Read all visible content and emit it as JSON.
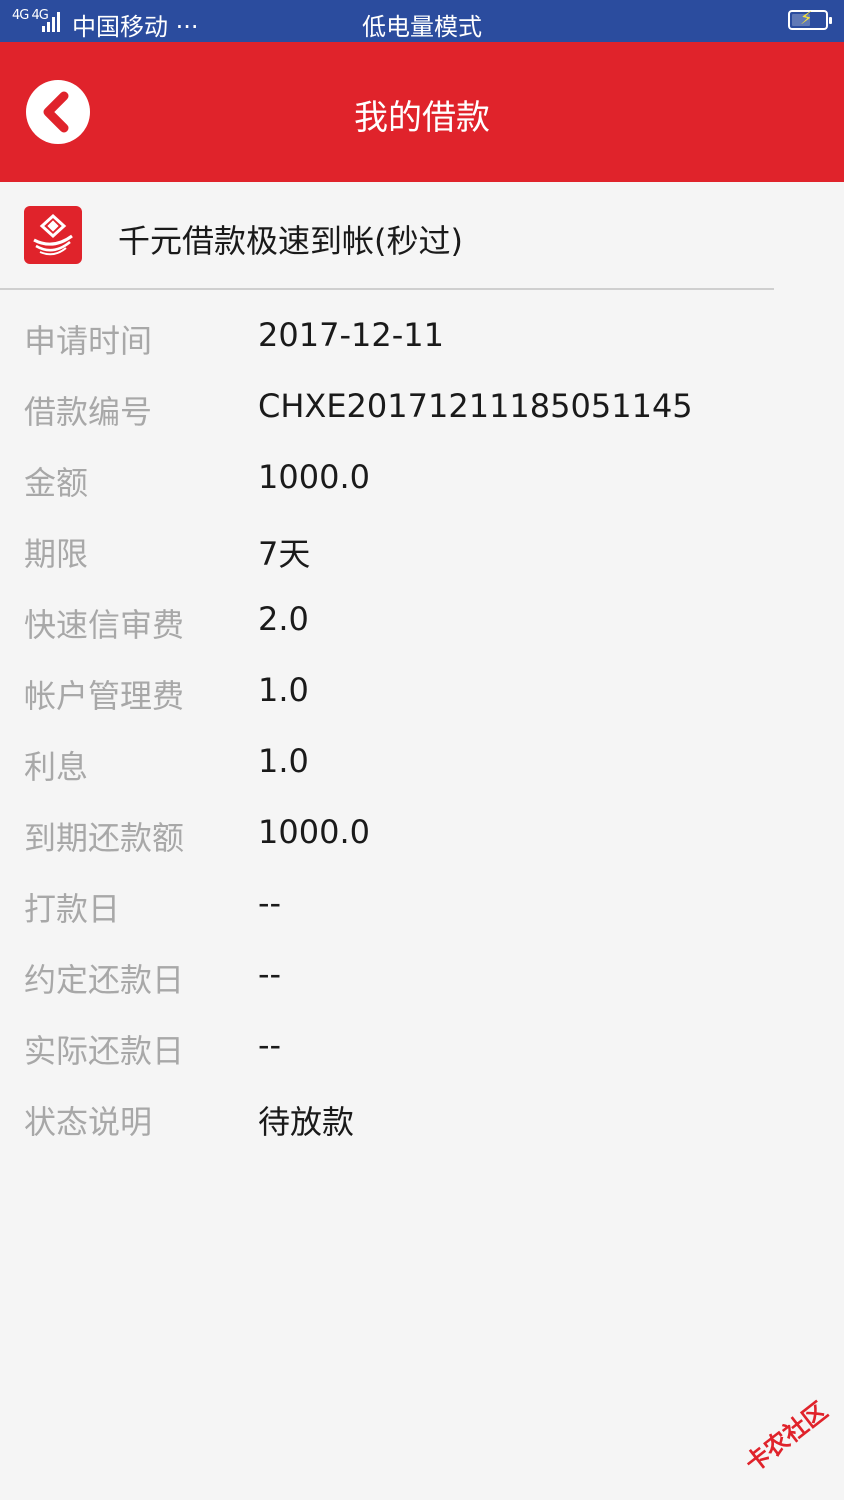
{
  "status_bar": {
    "network": "4G 4G",
    "carrier": "中国移动 ···",
    "mode": "低电量模式",
    "battery_icon": "battery-charging-icon"
  },
  "header": {
    "back_icon": "chevron-left-icon",
    "title": "我的借款"
  },
  "product": {
    "logo_icon": "product-logo",
    "name": "千元借款极速到帐(秒过)"
  },
  "details": [
    {
      "label": "申请时间",
      "value": "2017-12-11"
    },
    {
      "label": "借款编号",
      "value": "CHXE20171211185051145"
    },
    {
      "label": "金额",
      "value": "1000.0"
    },
    {
      "label": "期限",
      "value": "7天"
    },
    {
      "label": "快速信审费",
      "value": "2.0"
    },
    {
      "label": "帐户管理费",
      "value": "1.0"
    },
    {
      "label": "利息",
      "value": "1.0"
    },
    {
      "label": "到期还款额",
      "value": "1000.0"
    },
    {
      "label": "打款日",
      "value": "--"
    },
    {
      "label": "约定还款日",
      "value": "--"
    },
    {
      "label": "实际还款日",
      "value": "--"
    },
    {
      "label": "状态说明",
      "value": "待放款"
    }
  ],
  "watermark": "卡农社区",
  "colors": {
    "status_bar": "#2b4c9e",
    "accent": "#e0232b",
    "label": "#a8a8a8",
    "value": "#1a1a1a",
    "background": "#f5f5f5"
  }
}
